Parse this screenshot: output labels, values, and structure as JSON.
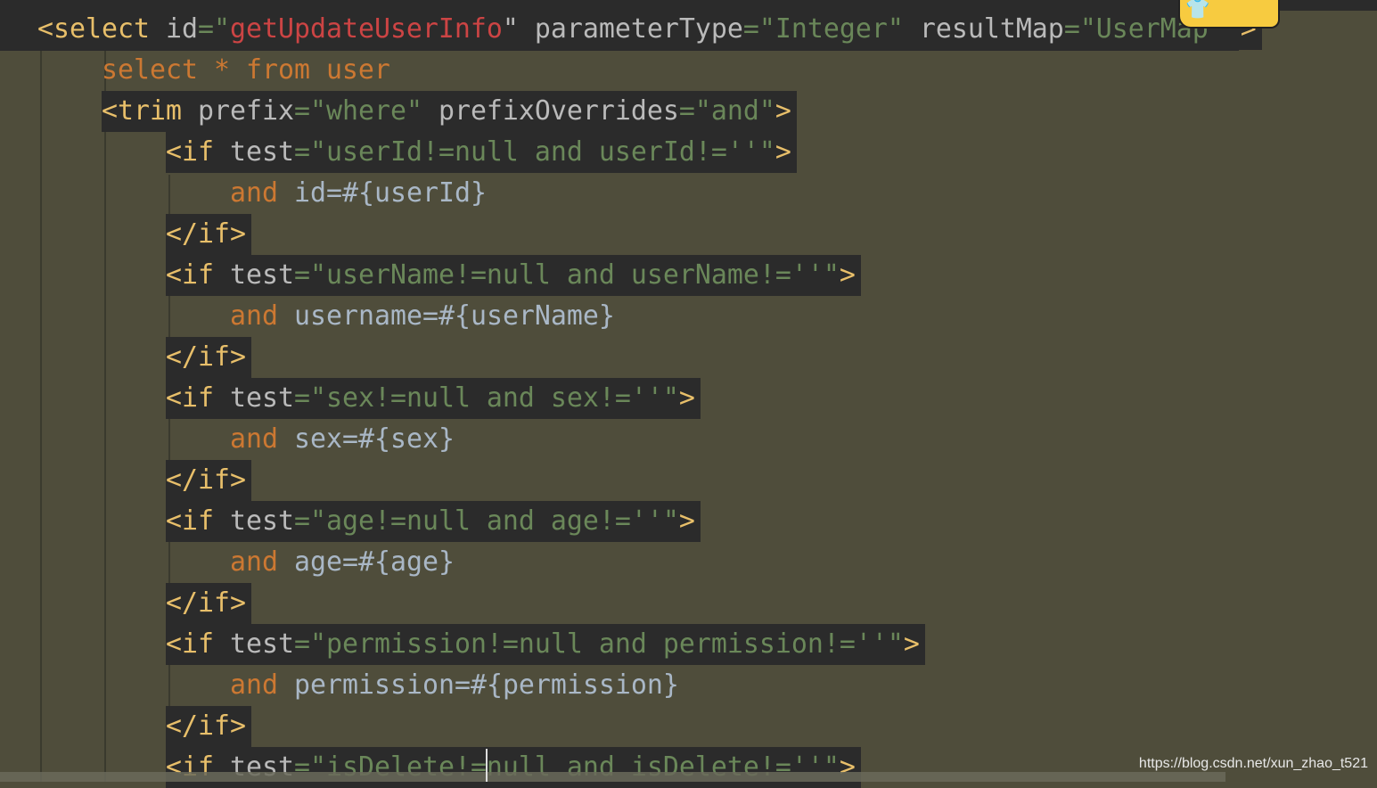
{
  "editor": {
    "lines": [
      {
        "indent": 0,
        "hl": true,
        "tokens": [
          [
            "t",
            "<select"
          ],
          [
            "a",
            " id"
          ],
          [
            "e",
            "=\""
          ],
          [
            "r",
            "getUpdateUserInfo"
          ],
          [
            "a",
            "\""
          ],
          [
            "a",
            " parameterType"
          ],
          [
            "e",
            "="
          ],
          [
            "v",
            "\"Integer\""
          ],
          [
            "a",
            " resultMap"
          ],
          [
            "e",
            "="
          ],
          [
            "v",
            "\"UserMap\""
          ],
          [
            "t",
            " >"
          ]
        ]
      },
      {
        "indent": 1,
        "hl": false,
        "tokens": [
          [
            "k",
            "select * from user"
          ]
        ]
      },
      {
        "indent": 1,
        "hl": true,
        "tokens": [
          [
            "t",
            "<trim"
          ],
          [
            "a",
            " prefix"
          ],
          [
            "e",
            "="
          ],
          [
            "v",
            "\"where\""
          ],
          [
            "a",
            " prefixOverrides"
          ],
          [
            "e",
            "="
          ],
          [
            "v",
            "\"and\""
          ],
          [
            "t",
            ">"
          ]
        ]
      },
      {
        "indent": 2,
        "hl": true,
        "tokens": [
          [
            "t",
            "<if"
          ],
          [
            "a",
            " test"
          ],
          [
            "e",
            "="
          ],
          [
            "v",
            "\"userId!=null and userId!=''\""
          ],
          [
            "t",
            ">"
          ]
        ]
      },
      {
        "indent": 3,
        "hl": false,
        "tokens": [
          [
            "k",
            "and"
          ],
          [
            "p",
            " id=#{userId}"
          ]
        ]
      },
      {
        "indent": 2,
        "hl": true,
        "tokens": [
          [
            "t",
            "</if>"
          ]
        ]
      },
      {
        "indent": 2,
        "hl": true,
        "tokens": [
          [
            "t",
            "<if"
          ],
          [
            "a",
            " test"
          ],
          [
            "e",
            "="
          ],
          [
            "v",
            "\"userName!=null and userName!=''\""
          ],
          [
            "t",
            ">"
          ]
        ]
      },
      {
        "indent": 3,
        "hl": false,
        "tokens": [
          [
            "k",
            "and"
          ],
          [
            "p",
            " username=#{userName}"
          ]
        ]
      },
      {
        "indent": 2,
        "hl": true,
        "tokens": [
          [
            "t",
            "</if>"
          ]
        ]
      },
      {
        "indent": 2,
        "hl": true,
        "tokens": [
          [
            "t",
            "<if"
          ],
          [
            "a",
            " test"
          ],
          [
            "e",
            "="
          ],
          [
            "v",
            "\"sex!=null and sex!=''\""
          ],
          [
            "t",
            ">"
          ]
        ]
      },
      {
        "indent": 3,
        "hl": false,
        "tokens": [
          [
            "k",
            "and"
          ],
          [
            "p",
            " sex=#{sex}"
          ]
        ]
      },
      {
        "indent": 2,
        "hl": true,
        "tokens": [
          [
            "t",
            "</if>"
          ]
        ]
      },
      {
        "indent": 2,
        "hl": true,
        "tokens": [
          [
            "t",
            "<if"
          ],
          [
            "a",
            " test"
          ],
          [
            "e",
            "="
          ],
          [
            "v",
            "\"age!=null and age!=''\""
          ],
          [
            "t",
            ">"
          ]
        ]
      },
      {
        "indent": 3,
        "hl": false,
        "tokens": [
          [
            "k",
            "and"
          ],
          [
            "p",
            " age=#{age}"
          ]
        ]
      },
      {
        "indent": 2,
        "hl": true,
        "tokens": [
          [
            "t",
            "</if>"
          ]
        ]
      },
      {
        "indent": 2,
        "hl": true,
        "tokens": [
          [
            "t",
            "<if"
          ],
          [
            "a",
            " test"
          ],
          [
            "e",
            "="
          ],
          [
            "v",
            "\"permission!=null and permission!=''\""
          ],
          [
            "t",
            ">"
          ]
        ]
      },
      {
        "indent": 3,
        "hl": false,
        "tokens": [
          [
            "k",
            "and"
          ],
          [
            "p",
            " permission=#{permission}"
          ]
        ]
      },
      {
        "indent": 2,
        "hl": true,
        "tokens": [
          [
            "t",
            "</if>"
          ]
        ]
      },
      {
        "indent": 2,
        "hl": true,
        "tokens": [
          [
            "t",
            "<if"
          ],
          [
            "a",
            " test"
          ],
          [
            "e",
            "="
          ],
          [
            "v",
            "\"isDelete!=null and isDelete!=''\""
          ],
          [
            "t",
            ">"
          ]
        ]
      }
    ]
  },
  "mascot_icon": "tshirt-icon",
  "watermark": "https://blog.csdn.net/xun_zhao_t521",
  "colors": {
    "background": "#4f4d3b",
    "highlight": "#2b2b2b",
    "tag": "#e8bf6a",
    "attr": "#bababa",
    "value": "#6a8759",
    "id_value": "#cc4444",
    "keyword": "#cc7832",
    "text": "#a9b7c6"
  }
}
